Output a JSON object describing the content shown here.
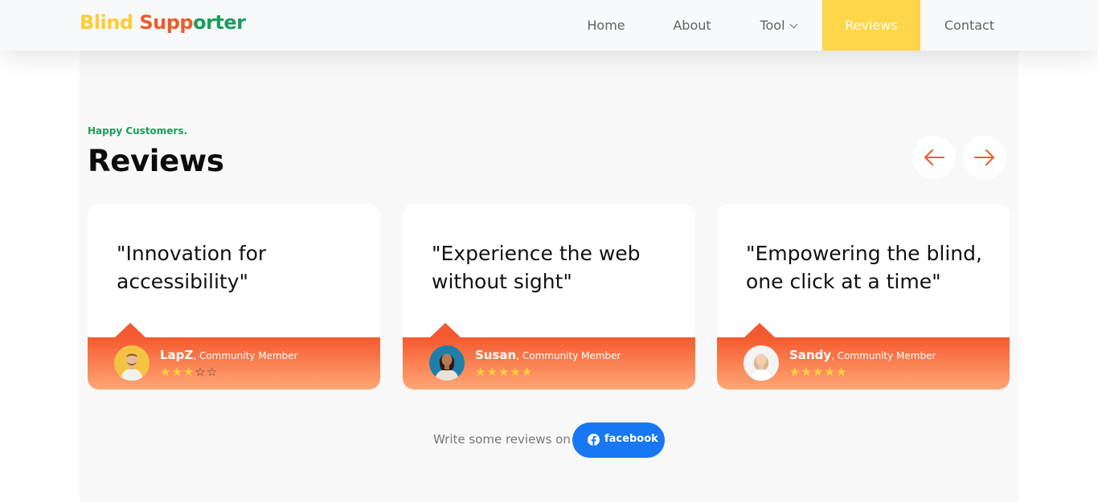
{
  "nav": {
    "brand": {
      "part1": "Blind",
      "part2": "Supp",
      "part3": "orter"
    },
    "links": [
      {
        "label": "Home"
      },
      {
        "label": "About"
      },
      {
        "label": "Tool"
      },
      {
        "label": "Reviews"
      },
      {
        "label": "Contact"
      }
    ],
    "colors": {
      "brand_yellow": "#ffcc33",
      "brand_orange": "#f15a29",
      "brand_green": "#1a9e5c",
      "active_bg": "#ffd54a"
    }
  },
  "section": {
    "eyebrow": "Happy Customers.",
    "title": "Reviews",
    "prev_icon": "arrow-left-icon",
    "next_icon": "arrow-right-icon"
  },
  "reviews": [
    {
      "quote": "\"Innovation for accessibility\"",
      "name": "LapZ",
      "role": "Community Member",
      "rating": 3,
      "max_rating": 5
    },
    {
      "quote": "\"Experience the web without sight\"",
      "name": "Susan",
      "role": "Community Member",
      "rating": 5,
      "max_rating": 5
    },
    {
      "quote": "\"Empowering the blind, one click at a time\"",
      "name": "Sandy",
      "role": "Community Member",
      "rating": 5,
      "max_rating": 5
    }
  ],
  "cta": {
    "text": "Write some reviews on",
    "button_label": "facebook",
    "button_icon": "facebook-icon",
    "button_color": "#1877f2"
  }
}
